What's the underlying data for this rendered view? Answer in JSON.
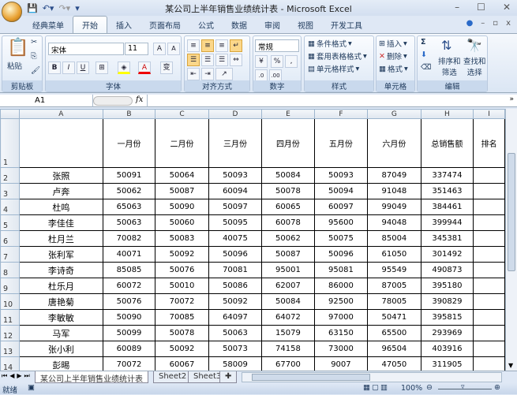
{
  "window": {
    "title": "某公司上半年销售业绩统计表 - Microsoft Excel",
    "minimize": "–",
    "maximize": "☐",
    "close": "✕"
  },
  "tabs": [
    "经典菜单",
    "开始",
    "插入",
    "页面布局",
    "公式",
    "数据",
    "审阅",
    "视图",
    "开发工具"
  ],
  "ribbon": {
    "clipboard": {
      "label": "剪贴板",
      "paste": "粘贴"
    },
    "font": {
      "label": "字体",
      "font_name": "宋体",
      "font_size": "11",
      "bold": "B",
      "italic": "I",
      "underline": "U",
      "grow": "A",
      "shrink": "A",
      "color": "A",
      "phonetic": "变"
    },
    "alignment": {
      "label": "对齐方式"
    },
    "number": {
      "label": "数字",
      "format": "常规",
      "percent": "%",
      "comma": ","
    },
    "styles": {
      "label": "样式",
      "conditional": "条件格式",
      "table": "套用表格格式",
      "cell": "单元格样式"
    },
    "cells": {
      "label": "单元格",
      "insert": "插入",
      "delete": "删除",
      "format": "格式"
    },
    "editing": {
      "label": "编辑",
      "sigma": "Σ",
      "sort_1": "排序和",
      "sort_2": "筛选",
      "find_1": "查找和",
      "find_2": "选择"
    }
  },
  "formula_bar": {
    "name_box": "A1",
    "fx": "fx",
    "value": ""
  },
  "columns": [
    "A",
    "B",
    "C",
    "D",
    "E",
    "F",
    "G",
    "H",
    "I"
  ],
  "headers": [
    "",
    "一月份",
    "二月份",
    "三月份",
    "四月份",
    "五月份",
    "六月份",
    "总销售额",
    "排名"
  ],
  "rows": [
    [
      "张照",
      "50091",
      "50064",
      "50093",
      "50084",
      "50093",
      "87049",
      "337474",
      ""
    ],
    [
      "卢奔",
      "50062",
      "50087",
      "60094",
      "50078",
      "50094",
      "91048",
      "351463",
      ""
    ],
    [
      "杜鸣",
      "65063",
      "50090",
      "50097",
      "60065",
      "60097",
      "99049",
      "384461",
      ""
    ],
    [
      "李佳佳",
      "50063",
      "50060",
      "50095",
      "60078",
      "95600",
      "94048",
      "399944",
      ""
    ],
    [
      "杜月兰",
      "70082",
      "50083",
      "40075",
      "50062",
      "50075",
      "85004",
      "345381",
      ""
    ],
    [
      "张利军",
      "40071",
      "50092",
      "50096",
      "50087",
      "50096",
      "61050",
      "301492",
      ""
    ],
    [
      "李诗奇",
      "85085",
      "50076",
      "70081",
      "95001",
      "95081",
      "95549",
      "490873",
      ""
    ],
    [
      "杜乐月",
      "60072",
      "50010",
      "50086",
      "62007",
      "86000",
      "87005",
      "395180",
      ""
    ],
    [
      "唐艳菊",
      "50076",
      "70072",
      "50092",
      "50084",
      "92500",
      "78005",
      "390829",
      ""
    ],
    [
      "李敏敏",
      "50090",
      "70085",
      "64097",
      "64072",
      "97000",
      "50471",
      "395815",
      ""
    ],
    [
      "马军",
      "50099",
      "50078",
      "50063",
      "15079",
      "63150",
      "65500",
      "293969",
      ""
    ],
    [
      "张小利",
      "60089",
      "50092",
      "50073",
      "74158",
      "73000",
      "96504",
      "403916",
      ""
    ],
    [
      "彭晹",
      "70072",
      "60067",
      "58009",
      "67700",
      "9007",
      "47050",
      "311905",
      ""
    ]
  ],
  "sheets": [
    "某公司上半年销售业绩统计表",
    "Sheet2",
    "Sheet3"
  ],
  "status": {
    "ready": "就绪",
    "zoom": "100%"
  }
}
